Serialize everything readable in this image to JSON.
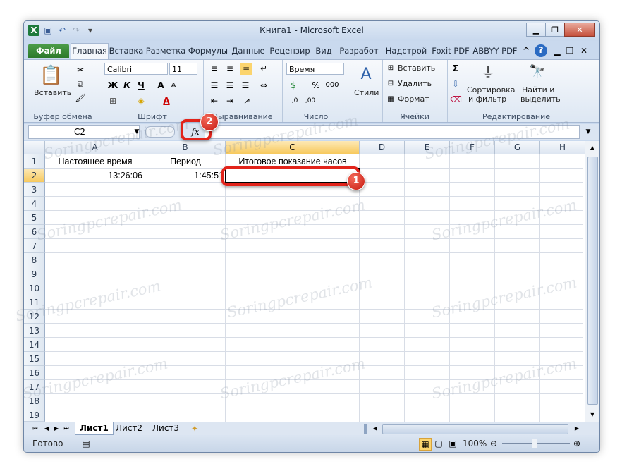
{
  "window": {
    "title": "Книга1  -  Microsoft Excel"
  },
  "tabs": [
    {
      "label": "Файл"
    },
    {
      "label": "Главная"
    },
    {
      "label": "Вставка"
    },
    {
      "label": "Разметка"
    },
    {
      "label": "Формулы"
    },
    {
      "label": "Данные"
    },
    {
      "label": "Рецензир"
    },
    {
      "label": "Вид"
    },
    {
      "label": "Разработ"
    },
    {
      "label": "Надстрой"
    },
    {
      "label": "Foxit PDF"
    },
    {
      "label": "ABBYY PDF"
    }
  ],
  "ribbon": {
    "clipboard": {
      "paste_label": "Вставить",
      "group_label": "Буфер обмена"
    },
    "font": {
      "name": "Calibri",
      "size": "11",
      "bold": "Ж",
      "italic": "К",
      "underline": "Ч",
      "group_label": "Шрифт"
    },
    "alignment": {
      "group_label": "Выравнивание"
    },
    "number": {
      "format": "Время",
      "percent": "%",
      "thousands": "000",
      "group_label": "Число"
    },
    "styles": {
      "label": "Стили"
    },
    "cells": {
      "insert": "Вставить",
      "delete": "Удалить",
      "format": "Формат",
      "group_label": "Ячейки"
    },
    "editing": {
      "sort_line1": "Сортировка",
      "sort_line2": "и фильтр",
      "find_line1": "Найти и",
      "find_line2": "выделить",
      "group_label": "Редактирование"
    }
  },
  "formula_bar": {
    "name_box": "C2",
    "fx": "fx",
    "formula": ""
  },
  "columns": [
    "A",
    "B",
    "C",
    "D",
    "E",
    "F",
    "G",
    "H"
  ],
  "rows": [
    "1",
    "2",
    "3",
    "4",
    "5",
    "6",
    "7",
    "8",
    "9",
    "10",
    "11",
    "12",
    "13",
    "14",
    "15",
    "16",
    "17",
    "18",
    "19"
  ],
  "cells": {
    "A1": "Настоящее время",
    "B1": "Период",
    "C1": "Итоговое показание часов",
    "A2": "13:26:06",
    "B2": "1:45:51"
  },
  "sheets": [
    {
      "label": "Лист1"
    },
    {
      "label": "Лист2"
    },
    {
      "label": "Лист3"
    }
  ],
  "status": {
    "ready": "Готово",
    "zoom": "100%"
  },
  "watermark": "Soringpcrepair.com",
  "annotations": [
    {
      "number": "1"
    },
    {
      "number": "2"
    }
  ],
  "colors": {
    "accent": "#e2231a",
    "file_tab": "#2d7a2b",
    "selection": "#f7c95e"
  }
}
